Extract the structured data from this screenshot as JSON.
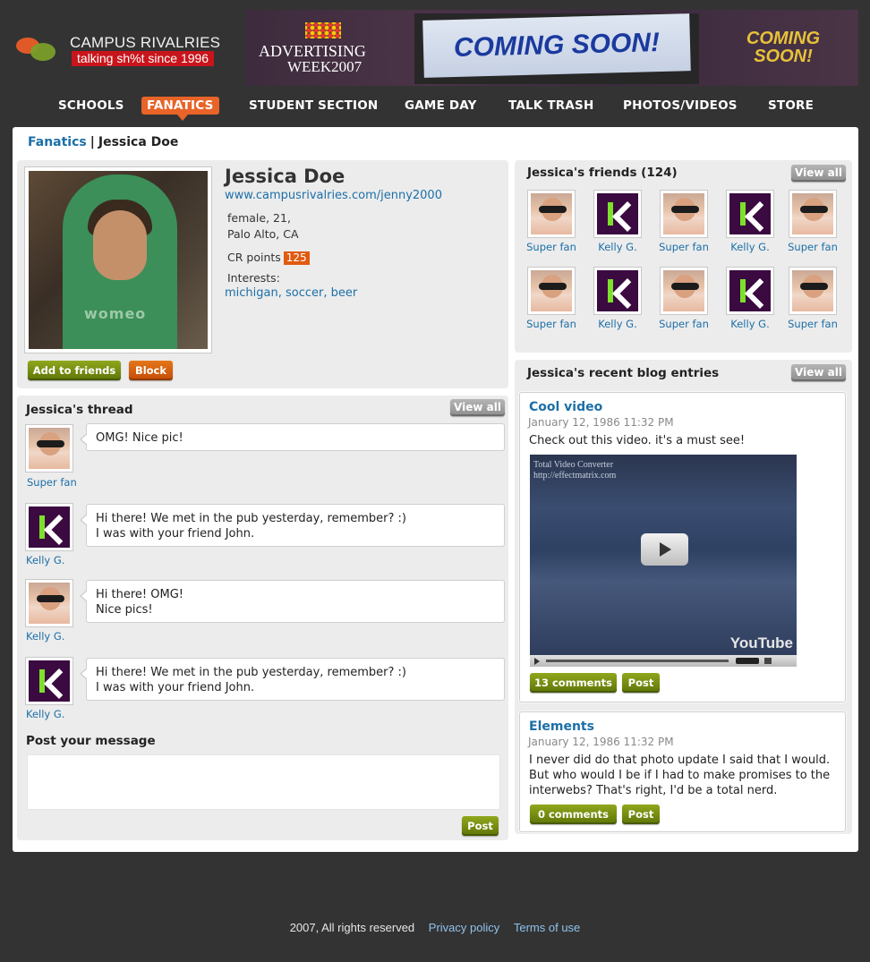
{
  "brand": {
    "name": "CAMPUS RIVALRIES",
    "tagline": "talking sh%t since 1996"
  },
  "banner": {
    "left_line1": "ADVERTISING",
    "left_line2": "WEEK2007",
    "center": "COMING SOON!",
    "right_line1": "COMING",
    "right_line2": "SOON!"
  },
  "nav": {
    "items": [
      {
        "label": "SCHOOLS"
      },
      {
        "label": "FANATICS"
      },
      {
        "label": "STUDENT SECTION"
      },
      {
        "label": "GAME DAY"
      },
      {
        "label": "TALK TRASH"
      },
      {
        "label": "PHOTOS/VIDEOS"
      },
      {
        "label": "STORE"
      }
    ],
    "active": "FANATICS"
  },
  "breadcrumb": {
    "parent": "Fanatics",
    "separator": "|",
    "current": "Jessica Doe"
  },
  "profile": {
    "name": "Jessica Doe",
    "url": "www.campusrivalries.com/jenny2000",
    "line1": "female, 21,",
    "line2": "Palo Alto, CA",
    "points_label": "CR points",
    "points": "125",
    "interests_label": "Interests:",
    "interests": "michigan, soccer, beer",
    "add_friend": "Add to friends",
    "block": "Block"
  },
  "thread": {
    "title": "Jessica's thread",
    "view_all": "View all",
    "messages": [
      {
        "user": "Super fan",
        "avatar": "fan",
        "line1": "OMG! Nice pic!",
        "line2": ""
      },
      {
        "user": "Kelly G.",
        "avatar": "k",
        "line1": "Hi there! We met in the pub yesterday, remember? :)",
        "line2": "I was with your friend John."
      },
      {
        "user": "Kelly G.",
        "avatar": "fan",
        "line1": "Hi there! OMG!",
        "line2": "Nice pics!"
      },
      {
        "user": "Kelly G.",
        "avatar": "k",
        "line1": "Hi there! We met in the pub yesterday, remember? :)",
        "line2": "I was with your friend John."
      }
    ],
    "post_label": "Post your message",
    "post_placeholder": "",
    "post_button": "Post"
  },
  "friends": {
    "title": "Jessica's friends (124)",
    "view_all": "View all",
    "list": [
      {
        "name": "Super fan",
        "avatar": "fan"
      },
      {
        "name": "Kelly G.",
        "avatar": "k"
      },
      {
        "name": "Super fan",
        "avatar": "fan"
      },
      {
        "name": "Kelly G.",
        "avatar": "k"
      },
      {
        "name": "Super fan",
        "avatar": "fan"
      },
      {
        "name": "Super fan",
        "avatar": "fan"
      },
      {
        "name": "Kelly G.",
        "avatar": "k"
      },
      {
        "name": "Super fan",
        "avatar": "fan"
      },
      {
        "name": "Kelly G.",
        "avatar": "k"
      },
      {
        "name": "Super fan",
        "avatar": "fan"
      }
    ]
  },
  "blog": {
    "title": "Jessica's recent blog entries",
    "view_all": "View all",
    "entries": [
      {
        "title": "Cool video",
        "date": "January 12, 1986 11:32 PM",
        "text": "Check out this video. it's a must see!",
        "video_caption1": "Total Video Converter",
        "video_caption2": "http://effectmatrix.com",
        "video_brand": "YouTube",
        "comments": "13 comments",
        "post": "Post"
      },
      {
        "title": "Elements",
        "date": "January 12, 1986 11:32 PM",
        "text": "I never did do that photo update I said that I would. But who would I be if I had to make promises to the interwebs? That's right, I'd be a total nerd.",
        "comments": "0 comments",
        "post": "Post"
      }
    ]
  },
  "footer": {
    "copyright": "2007, All rights reserved",
    "privacy": "Privacy policy",
    "terms": "Terms of use"
  },
  "colors": {
    "link": "#1c6fa8",
    "accent_orange": "#e86428",
    "button_green": "#6e8a0f",
    "background": "#333333"
  }
}
